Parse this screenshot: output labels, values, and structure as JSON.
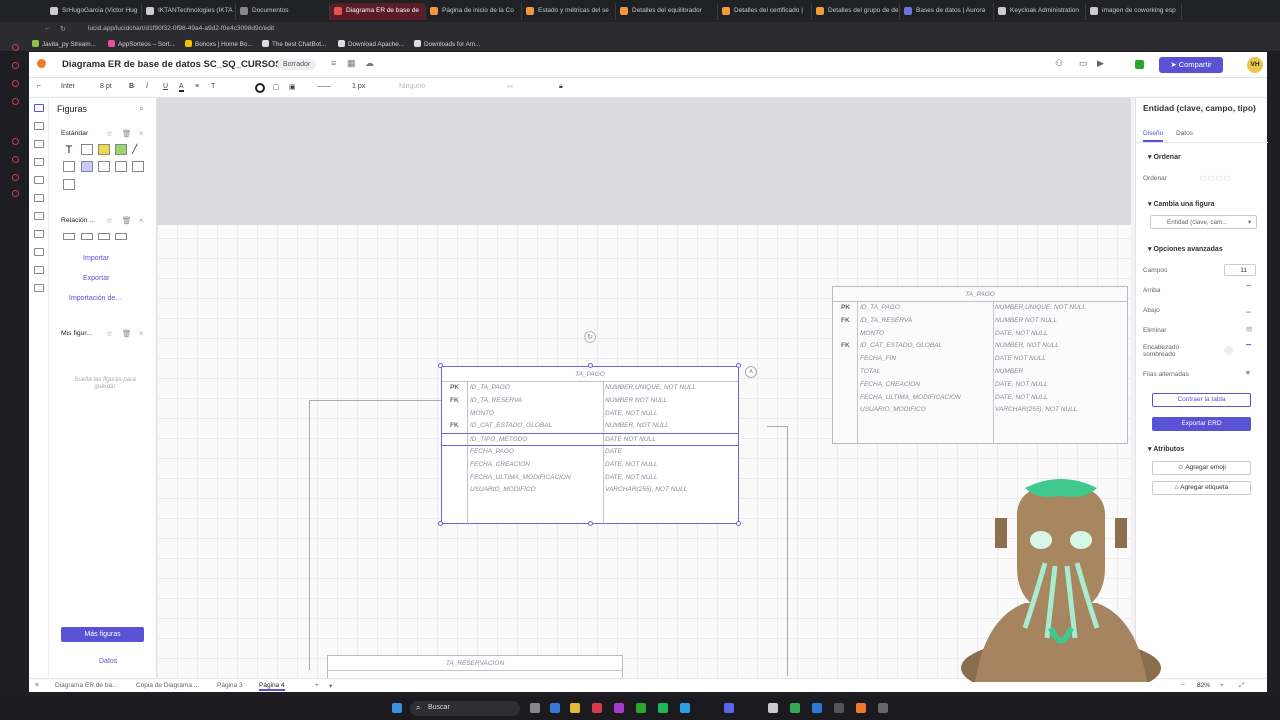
{
  "browser": {
    "tabs": [
      {
        "label": "SrHugoGarcia (Victor Hug",
        "color": "#cccccc"
      },
      {
        "label": "IKTANTechnologies (IKTA",
        "color": "#cccccc"
      },
      {
        "label": "Documentos",
        "color": "#888888"
      },
      {
        "label": "Diagrama ER de base de",
        "color": "#e0564f",
        "active": true
      },
      {
        "label": "Página de inicio de la Co",
        "color": "#f29a38"
      },
      {
        "label": "Estado y métricas del se",
        "color": "#f29a38"
      },
      {
        "label": "Detalles del equilibrador",
        "color": "#f29a38"
      },
      {
        "label": "Detalles del certificado |",
        "color": "#f29a38"
      },
      {
        "label": "Detalles del grupo de de",
        "color": "#f29a38"
      },
      {
        "label": "Bases de datos | Aurora",
        "color": "#6b73e0"
      },
      {
        "label": "Keycloak Administration",
        "color": "#cccccc"
      },
      {
        "label": "imagen de coworking esp",
        "color": "#cccccc"
      }
    ],
    "url": "lucid.app/lucidchart/d1f90f32-0f98-49a4-a9d2-f0e4c3098d9c/edit",
    "bookmarks": [
      {
        "label": "Javita_py Stream...",
        "color": "#8bc34a"
      },
      {
        "label": "AppSorteos – Sort...",
        "color": "#e94fa0"
      },
      {
        "label": "Bonoxs | Home Bo...",
        "color": "#f2c200"
      },
      {
        "label": "The best ChatBot...",
        "color": "#dddddd"
      },
      {
        "label": "Download Apache...",
        "color": "#dddddd"
      },
      {
        "label": "Downloads for Am...",
        "color": "#dddddd"
      }
    ]
  },
  "app": {
    "title": "Diagrama ER de base de datos SC_SQ_CURSOS",
    "status": "Borrador",
    "share_label": "Compartir",
    "avatar": "VH",
    "toolbar": {
      "font": "Inter",
      "size": "8 pt",
      "line_width": "1 px",
      "none": "Ninguno"
    }
  },
  "leftpanel": {
    "title": "Figuras",
    "section_standard": "Estándar",
    "section_relation": "Relación ...",
    "import": "Importar",
    "export": "Exportar",
    "import_from": "Importación de...",
    "my_shapes": "Mis figur...",
    "drag_hint": "Suelta las figuras para guardar",
    "more_shapes": "Más figuras",
    "data": "Datos"
  },
  "tables": {
    "selected": {
      "name": "TA_PAGO",
      "rows": [
        {
          "key": "PK",
          "field": "ID_TA_PAGO",
          "type": "NUMBER,UNIQUE, NOT NULL"
        },
        {
          "key": "FK",
          "field": "ID_TA_RESERVA",
          "type": "NUMBER NOT NULL"
        },
        {
          "key": "",
          "field": "MONTO",
          "type": "DATE, NOT NULL"
        },
        {
          "key": "FK",
          "field": "ID_CAT_ESTADO_GLOBAL",
          "type": "NUMBER, NOT NULL"
        },
        {
          "key": "",
          "field": "ID_TIPO_METODO",
          "type": "DATE NOT NULL"
        },
        {
          "key": "",
          "field": "FECHA_PAGO",
          "type": "DATE"
        },
        {
          "key": "",
          "field": "FECHA_CREACION",
          "type": "DATE, NOT NULL"
        },
        {
          "key": "",
          "field": "FECHA_ULTIMA_MODIFICACION",
          "type": "DATE, NOT NULL"
        },
        {
          "key": "",
          "field": "USUARIO_MODIFICO",
          "type": "VARCHAR(255), NOT NULL"
        }
      ]
    },
    "right": {
      "name": "TA_PAGO",
      "rows": [
        {
          "key": "PK",
          "field": "ID_TA_PAGO",
          "type": "NUMBER,UNIQUE, NOT NULL"
        },
        {
          "key": "FK",
          "field": "ID_TA_RESERVA",
          "type": "NUMBER NOT NULL"
        },
        {
          "key": "",
          "field": "MONTO",
          "type": "DATE, NOT NULL"
        },
        {
          "key": "FK",
          "field": "ID_CAT_ESTADO_GLOBAL",
          "type": "NUMBER, NOT NULL"
        },
        {
          "key": "",
          "field": "FECHA_FIN",
          "type": "DATE NOT NULL"
        },
        {
          "key": "",
          "field": "TOTAL",
          "type": "NUMBER"
        },
        {
          "key": "",
          "field": "FECHA_CREACION",
          "type": "DATE, NOT NULL"
        },
        {
          "key": "",
          "field": "FECHA_ULTIMA_MODIFICACION",
          "type": "DATE, NOT NULL"
        },
        {
          "key": "",
          "field": "USUARIO_MODIFICO",
          "type": "VARCHAR(255), NOT NULL"
        }
      ]
    },
    "bottom": {
      "name": "TA_RESERVACION"
    }
  },
  "rightpanel": {
    "title": "Entidad (clave, campo, tipo)",
    "tab_design": "Diseño",
    "tab_data": "Datos",
    "order_header": "Ordenar",
    "order_label": "Ordenar",
    "change_shape": "Cambia una figura",
    "shape_select": "Entidad (clave, cam...",
    "advanced": "Opciones avanzadas",
    "fields_label": "Campos",
    "fields_value": "11",
    "above": "Arriba",
    "below": "Abajo",
    "delete": "Eliminar",
    "shaded_header": "Encabezado sombreado",
    "alt_rows": "Filas alternadas",
    "collapse_btn": "Contraer la tabla",
    "export_btn": "Exportar ERD",
    "attributes": "Atributos",
    "add_emoji": "Agregar emoji",
    "add_tag": "Agregar etiqueta"
  },
  "bottombar": {
    "pages": [
      "Diagrama ER de ba...",
      "Copia de Diagrama ...",
      "Página 3",
      "Página 4"
    ],
    "zoom": "82%"
  },
  "taskbar": {
    "search": "Buscar"
  }
}
